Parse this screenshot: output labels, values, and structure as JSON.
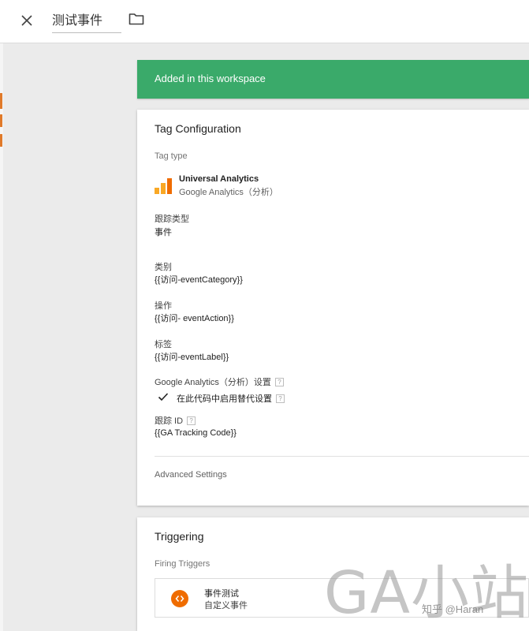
{
  "topbar": {
    "title": "测试事件",
    "close_icon": "close-icon",
    "folder_icon": "folder-icon"
  },
  "notification": {
    "text": "Added in this workspace",
    "color": "#3aaa6a"
  },
  "tag_configuration": {
    "title": "Tag Configuration",
    "tag_type_label": "Tag type",
    "tag_type_name": "Universal Analytics",
    "tag_type_sub": "Google Analytics（分析）",
    "track_type_label": "跟踪类型",
    "track_type_value": "事件",
    "category_label": "类别",
    "category_value": "{{访问-eventCategory}}",
    "action_label": "操作",
    "action_value": "{{访问- eventAction}}",
    "label_label": "标签",
    "label_value": "{{访问-eventLabel}}",
    "ga_settings_label": "Google Analytics（分析）设置",
    "override_label": "在此代码中启用替代设置",
    "tracking_id_label": "跟踪 ID",
    "tracking_id_value": "{{GA Tracking Code}}",
    "help_glyph": "?",
    "advanced_settings": "Advanced Settings"
  },
  "triggering": {
    "title": "Triggering",
    "firing_label": "Firing Triggers",
    "trigger_name": "事件测试",
    "trigger_type": "自定义事件",
    "trigger_icon_color": "#ef6c00"
  },
  "watermark": {
    "big": "GA小站",
    "small": "知乎 @Haran"
  }
}
